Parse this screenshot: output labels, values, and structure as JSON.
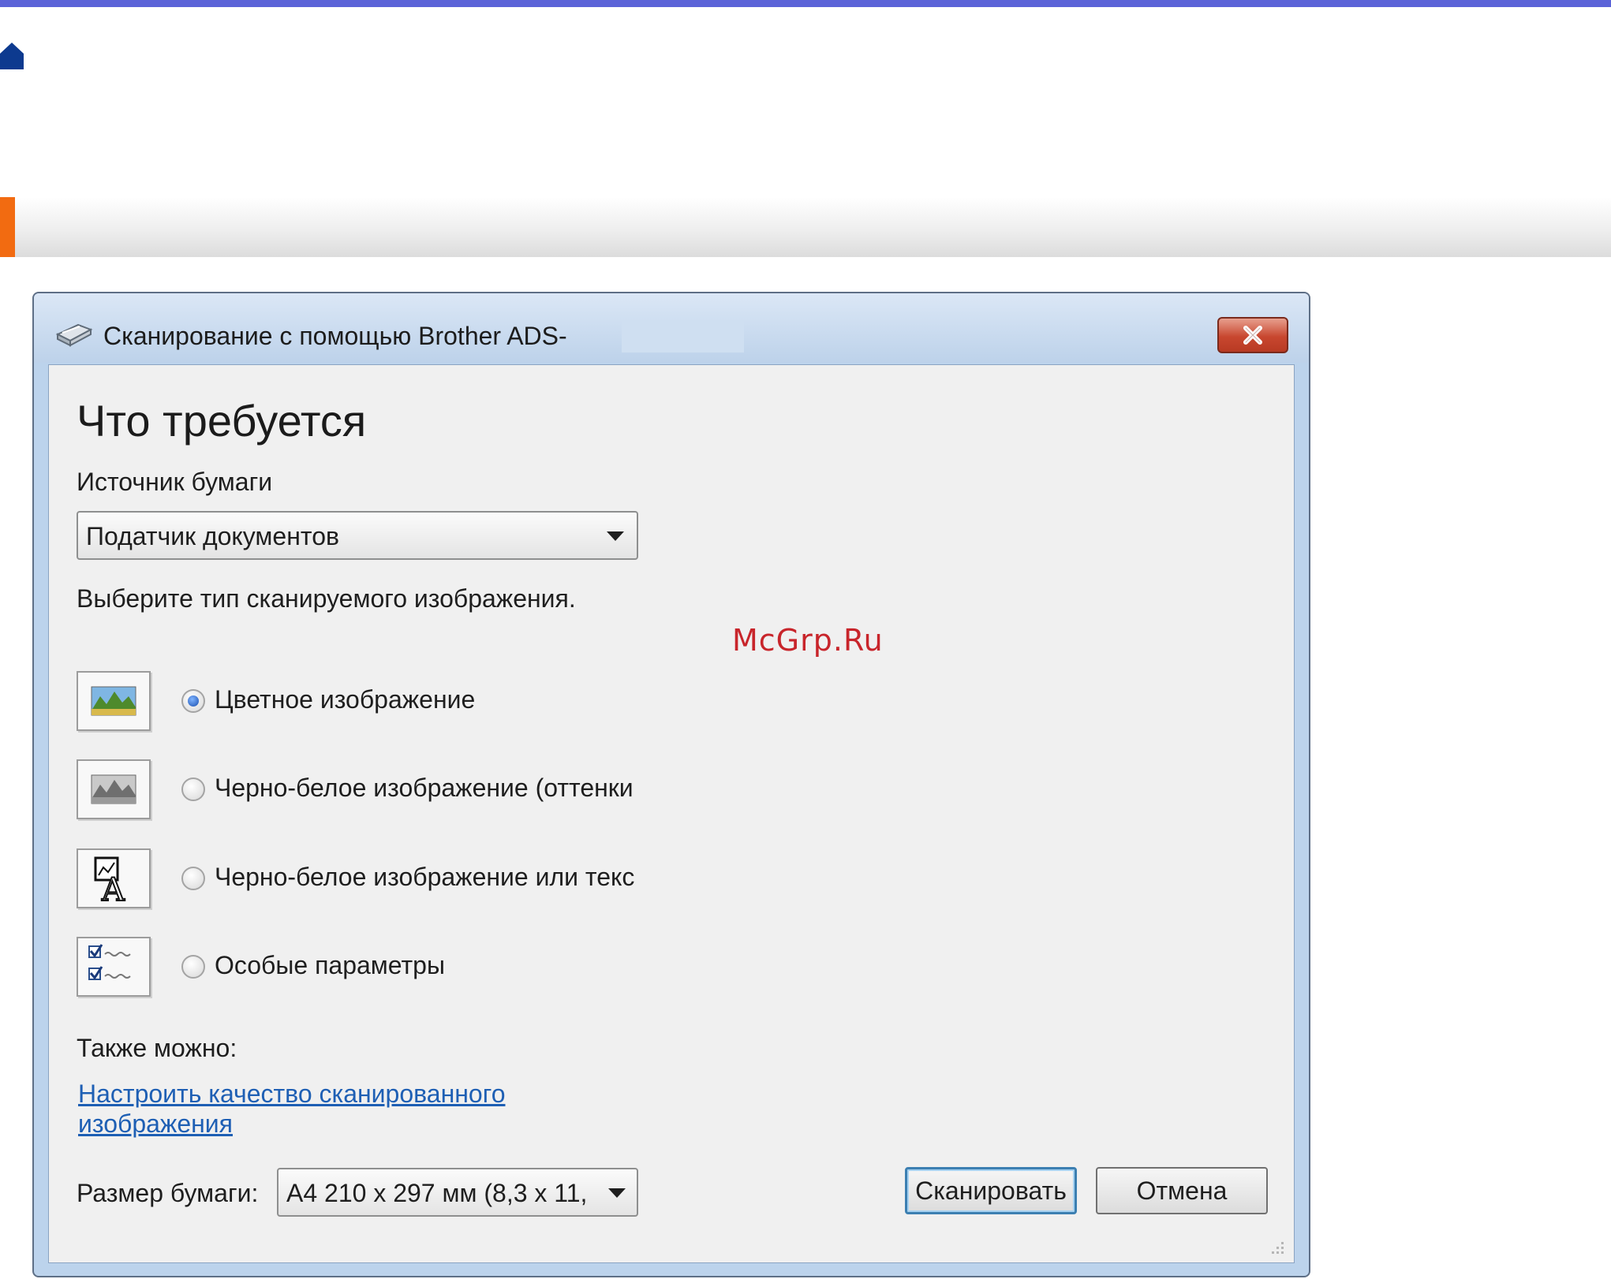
{
  "colors": {
    "top_rule": "#5b63d8",
    "section_marker": "#f26b11",
    "link": "#1e5fb4",
    "home_icon": "#0d3a8f"
  },
  "dialog": {
    "title": "Сканирование с помощью Brother ADS-",
    "heading": "Что требуется",
    "paper_source_label": "Источник бумаги",
    "paper_source_value": "Податчик документов",
    "image_type_prompt": "Выберите тип сканируемого изображения.",
    "options": [
      {
        "label": "Цветное изображение",
        "icon": "color-picture-icon",
        "selected": true
      },
      {
        "label": "Черно-белое изображение (оттенки",
        "icon": "grayscale-picture-icon",
        "selected": false
      },
      {
        "label": "Черно-белое изображение или текс",
        "icon": "bw-text-icon",
        "selected": false
      },
      {
        "label": "Особые параметры",
        "icon": "custom-settings-icon",
        "selected": false
      }
    ],
    "also_label": "Также можно:",
    "quality_link_line1": "Настроить качество сканированного ",
    "quality_link_line2": "изображения",
    "paper_size_label": "Размер бумаги:",
    "paper_size_value": "A4 210 x 297 мм (8,3 x 11,",
    "scan_button": "Сканировать",
    "cancel_button": "Отмена"
  },
  "watermark": "McGrp.Ru"
}
